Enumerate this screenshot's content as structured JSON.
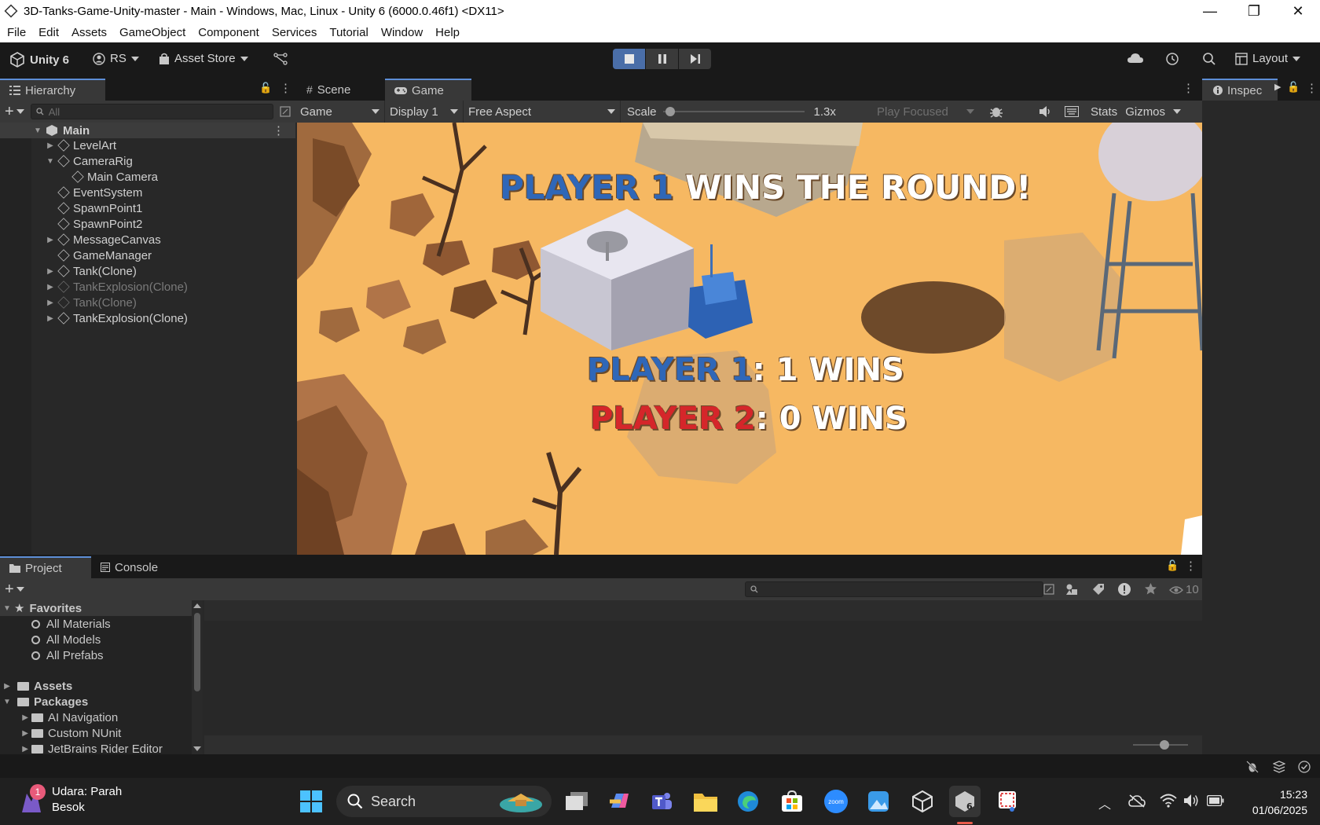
{
  "window": {
    "title": "3D-Tanks-Game-Unity-master - Main - Windows, Mac, Linux - Unity 6 (6000.0.46f1) <DX11>",
    "controls": [
      "—",
      "❐",
      "✕"
    ]
  },
  "menu": [
    "File",
    "Edit",
    "Assets",
    "GameObject",
    "Component",
    "Services",
    "Tutorial",
    "Window",
    "Help"
  ],
  "toolbar": {
    "unity_label": "Unity 6",
    "account_label": "RS",
    "asset_store_label": "Asset Store",
    "layout_label": "Layout"
  },
  "hierarchy": {
    "tab_label": "Hierarchy",
    "search_placeholder": "All",
    "items": [
      {
        "label": "Main"
      },
      {
        "label": "LevelArt"
      },
      {
        "label": "CameraRig"
      },
      {
        "label": "Main Camera"
      },
      {
        "label": "EventSystem"
      },
      {
        "label": "SpawnPoint1"
      },
      {
        "label": "SpawnPoint2"
      },
      {
        "label": "MessageCanvas"
      },
      {
        "label": "GameManager"
      },
      {
        "label": "Tank(Clone)"
      },
      {
        "label": "TankExplosion(Clone)"
      },
      {
        "label": "Tank(Clone)"
      },
      {
        "label": "TankExplosion(Clone)"
      }
    ]
  },
  "game_panel": {
    "tabs": [
      "Scene",
      "Game"
    ],
    "view_mode": "Game",
    "display": "Display 1",
    "aspect": "Free Aspect",
    "scale_label": "Scale",
    "scale_value": "1.3x",
    "scale_level": 0.02,
    "play_mode": "Play Focused",
    "stats_label": "Stats",
    "gizmos_label": "Gizmos"
  },
  "game_ui": {
    "round_player": "PLAYER 1",
    "round_text": " WINS THE ROUND!",
    "p1_name": "PLAYER 1",
    "p1_score": ": 1 WINS",
    "p2_name": "PLAYER 2",
    "p2_score": ": 0 WINS"
  },
  "inspector": {
    "tab_label": "Inspec"
  },
  "project": {
    "tabs": [
      "Project",
      "Console"
    ],
    "hidden_count": "10",
    "tree": {
      "favorites": "Favorites",
      "fav_items": [
        "All Materials",
        "All Models",
        "All Prefabs"
      ],
      "assets": "Assets",
      "packages": "Packages",
      "package_items": [
        "AI Navigation",
        "Custom NUnit",
        "JetBrains Rider Editor"
      ]
    }
  },
  "taskbar": {
    "notification_user": "Udara: Parah",
    "notification_sub": "Besok",
    "badge": "1",
    "search_label": "Search",
    "clock_time": "15:23",
    "clock_date": "01/06/2025",
    "zoom_label": "zoom"
  },
  "colors": {
    "accent": "#4a6ea8",
    "game_sand": "#f6b862",
    "player1_blue": "#2f67b8",
    "player2_red": "#d5262a"
  }
}
